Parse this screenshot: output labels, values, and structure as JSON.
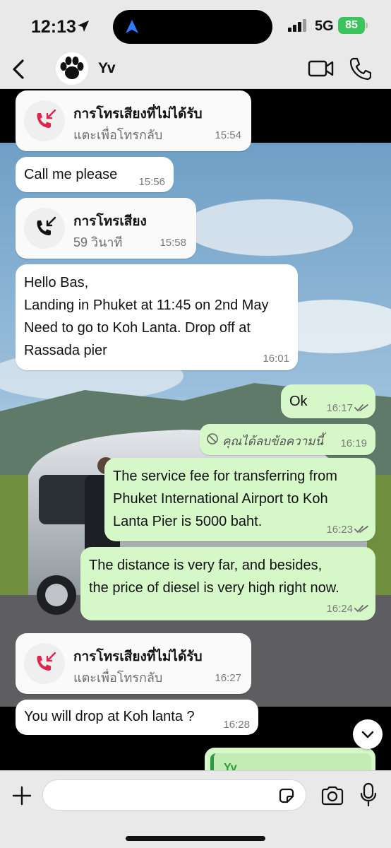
{
  "status_bar": {
    "time": "12:13",
    "network": "5G",
    "battery": "85",
    "icons": [
      "location-arrow-icon",
      "navigation-icon",
      "signal-icon",
      "battery-charging-icon"
    ]
  },
  "header": {
    "contact_name": "Yv",
    "icons": [
      "back-icon",
      "paw-avatar",
      "video-call-icon",
      "phone-icon"
    ]
  },
  "messages": [
    {
      "type": "missed_call",
      "title": "การโทรเสียงที่ไม่ได้รับ",
      "subtitle": "แตะเพื่อโทรกลับ",
      "time": "15:54"
    },
    {
      "type": "text_in",
      "text": "Call me please",
      "time": "15:56"
    },
    {
      "type": "voice_call",
      "title": "การโทรเสียง",
      "subtitle": "59 วินาที",
      "time": "15:58"
    },
    {
      "type": "text_in",
      "text": "Hello Bas,\nLanding in Phuket at 11:45 on 2nd May\nNeed to go to Koh Lanta. Drop off at\nRassada pier",
      "time": "16:01"
    },
    {
      "type": "text_out",
      "text": "Ok",
      "time": "16:17",
      "status": "read"
    },
    {
      "type": "deleted_out",
      "text": "คุณได้ลบข้อความนี้",
      "time": "16:19"
    },
    {
      "type": "text_out",
      "text": "The service fee for transferring from\nPhuket International Airport to Koh\nLanta Pier is 5000 baht.",
      "time": "16:23",
      "status": "read"
    },
    {
      "type": "text_out",
      "text": "The distance is very far, and besides,\nthe price of diesel is very high right now.",
      "time": "16:24",
      "status": "read"
    },
    {
      "type": "missed_call",
      "title": "การโทรเสียงที่ไม่ได้รับ",
      "subtitle": "แตะเพื่อโทรกลับ",
      "time": "16:27"
    },
    {
      "type": "text_in",
      "text": "You will drop at Koh lanta ?",
      "time": "16:28"
    },
    {
      "type": "reply_out",
      "quoted_name": "Yv"
    }
  ],
  "input": {
    "placeholder": "",
    "icons": [
      "plus-icon",
      "sticker-icon",
      "camera-icon",
      "microphone-icon"
    ]
  },
  "colors": {
    "outgoing_bubble": "#d6f8c9",
    "incoming_bubble": "#ffffff",
    "missed_call_red": "#e0244b",
    "battery_green": "#3bc45b",
    "quote_green": "#2c9a41"
  }
}
